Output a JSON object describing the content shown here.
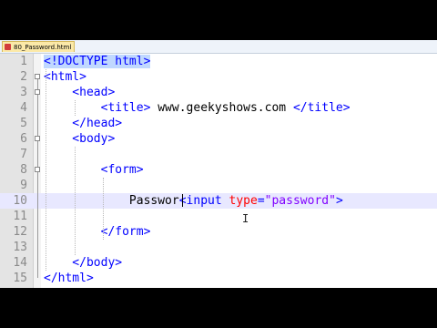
{
  "tab": {
    "title": "80_Password.html",
    "icon": "html-file-icon"
  },
  "lines": [
    {
      "n": "1",
      "tokens": [
        {
          "t": "<!DOCTYPE html>",
          "c": "tag hl"
        }
      ]
    },
    {
      "n": "2",
      "tokens": [
        {
          "t": "<html>",
          "c": "tag"
        }
      ]
    },
    {
      "n": "3",
      "tokens": [
        {
          "t": "    <head>",
          "c": "tag"
        }
      ]
    },
    {
      "n": "4",
      "tokens": [
        {
          "t": "        <title>",
          "c": "tag"
        },
        {
          "t": " www.geekyshows.com ",
          "c": ""
        },
        {
          "t": "</title>",
          "c": "tag"
        }
      ]
    },
    {
      "n": "5",
      "tokens": [
        {
          "t": "    </head>",
          "c": "tag"
        }
      ]
    },
    {
      "n": "6",
      "tokens": [
        {
          "t": "    <body>",
          "c": "tag"
        }
      ]
    },
    {
      "n": "7",
      "tokens": []
    },
    {
      "n": "8",
      "tokens": [
        {
          "t": "        <form>",
          "c": "tag"
        }
      ]
    },
    {
      "n": "9",
      "tokens": []
    },
    {
      "n": "10",
      "tokens": [
        {
          "t": "            Passwor",
          "c": ""
        },
        {
          "t": "<input ",
          "c": "tag"
        },
        {
          "t": "type",
          "c": "attr"
        },
        {
          "t": "=",
          "c": "tag"
        },
        {
          "t": "\"password\"",
          "c": "str"
        },
        {
          "t": ">",
          "c": "tag"
        }
      ]
    },
    {
      "n": "11",
      "tokens": []
    },
    {
      "n": "12",
      "tokens": [
        {
          "t": "        </form>",
          "c": "tag"
        }
      ]
    },
    {
      "n": "13",
      "tokens": []
    },
    {
      "n": "14",
      "tokens": [
        {
          "t": "    </body>",
          "c": "tag"
        }
      ]
    },
    {
      "n": "15",
      "tokens": [
        {
          "t": "</html>",
          "c": "tag"
        }
      ]
    }
  ],
  "colors": {
    "tag": "#0000ff",
    "attribute": "#ff0000",
    "string": "#8000ff",
    "text": "#000000"
  }
}
